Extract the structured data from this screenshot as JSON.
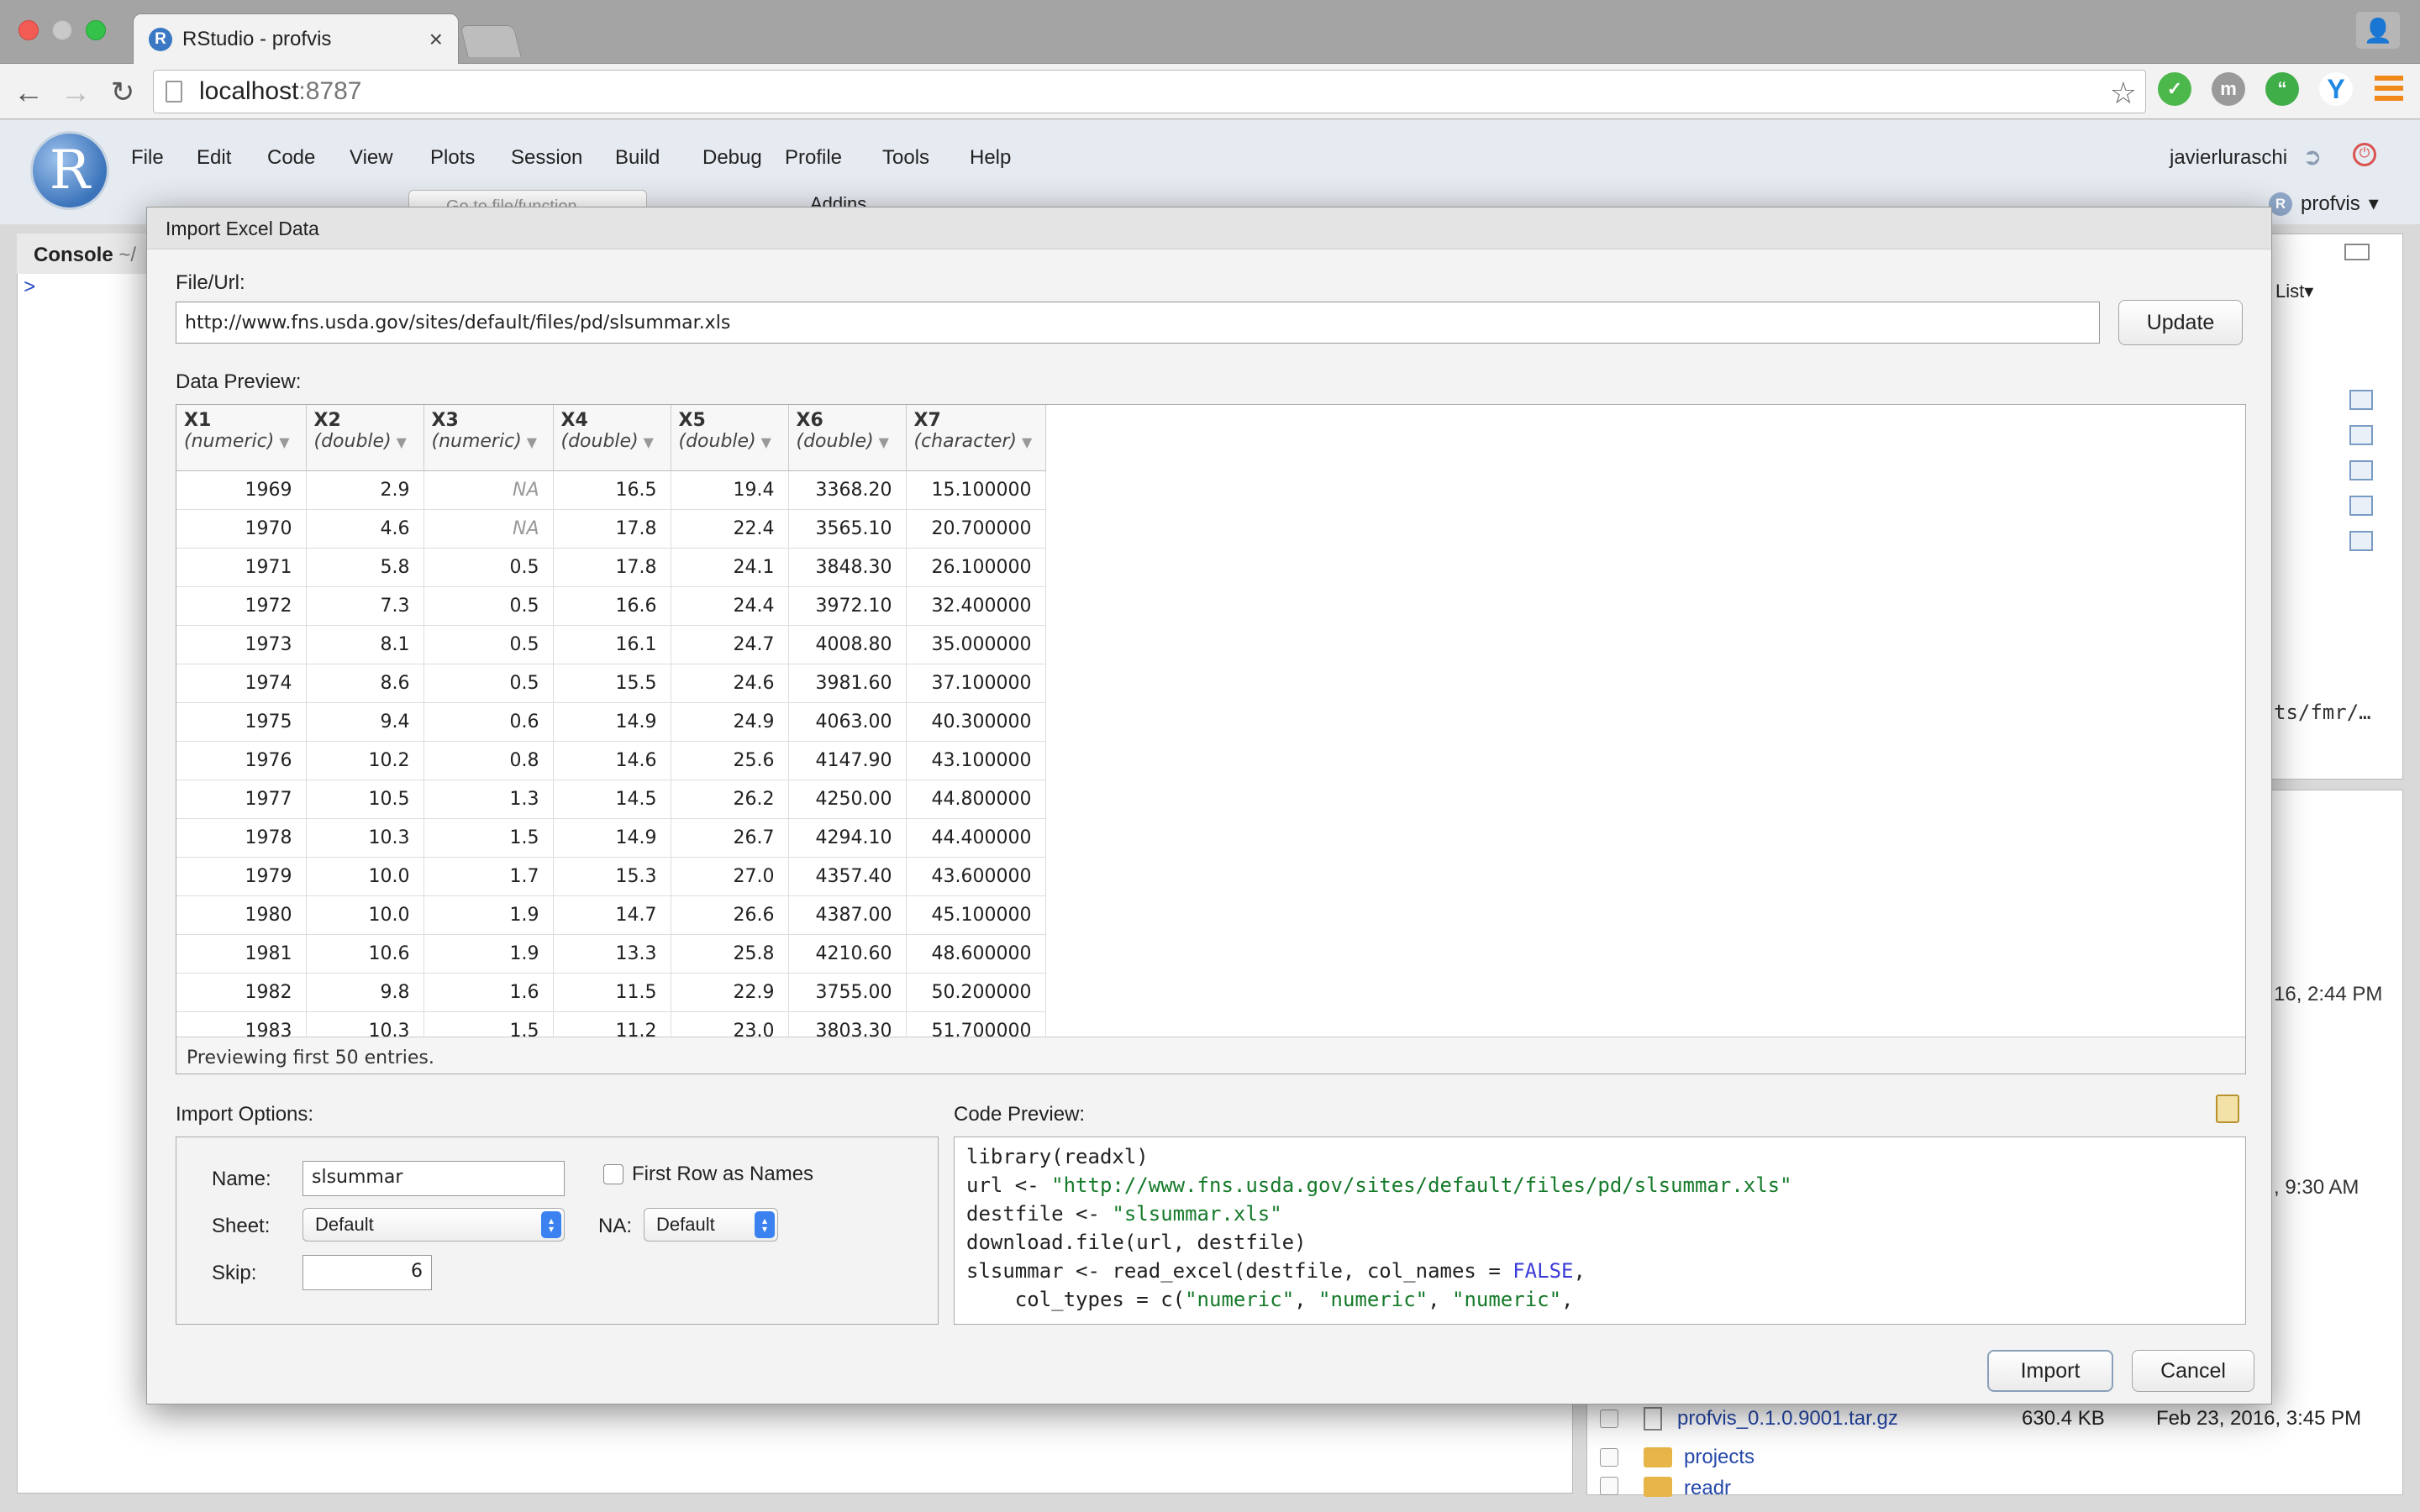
{
  "browser": {
    "tab_title": "RStudio - profvis",
    "tab_close": "×",
    "url_host": "localhost",
    "url_port": ":8787",
    "ext_m": "m"
  },
  "rstudio": {
    "logo": "R",
    "menu": [
      "File",
      "Edit",
      "Code",
      "View",
      "Plots",
      "Session",
      "Build",
      "Debug",
      "Profile",
      "Tools",
      "Help"
    ],
    "user": "javierluraschi",
    "project": "profvis",
    "project_arrow": "▾",
    "go_to_file": "Go to file/function",
    "addins": "Addins",
    "console_tab": "Console",
    "console_path": "~/",
    "prompt": ">",
    "env_view": "List",
    "env_path_fragment": "ts/fmr/…",
    "file_dates_partial": [
      "16, 2:44 PM",
      ", 9:30 AM"
    ],
    "files": [
      {
        "name": "profvis_0.1.0.9001.tar.gz",
        "size": "630.4 KB",
        "date": "Feb 23, 2016, 3:45 PM",
        "folder": false
      },
      {
        "name": "projects",
        "size": "",
        "date": "",
        "folder": true
      },
      {
        "name": "readr",
        "size": "",
        "date": "",
        "folder": true
      }
    ]
  },
  "dialog": {
    "title": "Import Excel Data",
    "file_label": "File/Url:",
    "url_value": "http://www.fns.usda.gov/sites/default/files/pd/slsummar.xls",
    "update_button": "Update",
    "data_preview_label": "Data Preview:",
    "columns": [
      {
        "name": "X1",
        "type": "(numeric)"
      },
      {
        "name": "X2",
        "type": "(double)"
      },
      {
        "name": "X3",
        "type": "(numeric)"
      },
      {
        "name": "X4",
        "type": "(double)"
      },
      {
        "name": "X5",
        "type": "(double)"
      },
      {
        "name": "X6",
        "type": "(double)"
      },
      {
        "name": "X7",
        "type": "(character)"
      }
    ],
    "rows": [
      [
        "1969",
        "2.9",
        "NA",
        "16.5",
        "19.4",
        "3368.20",
        "15.100000"
      ],
      [
        "1970",
        "4.6",
        "NA",
        "17.8",
        "22.4",
        "3565.10",
        "20.700000"
      ],
      [
        "1971",
        "5.8",
        "0.5",
        "17.8",
        "24.1",
        "3848.30",
        "26.100000"
      ],
      [
        "1972",
        "7.3",
        "0.5",
        "16.6",
        "24.4",
        "3972.10",
        "32.400000"
      ],
      [
        "1973",
        "8.1",
        "0.5",
        "16.1",
        "24.7",
        "4008.80",
        "35.000000"
      ],
      [
        "1974",
        "8.6",
        "0.5",
        "15.5",
        "24.6",
        "3981.60",
        "37.100000"
      ],
      [
        "1975",
        "9.4",
        "0.6",
        "14.9",
        "24.9",
        "4063.00",
        "40.300000"
      ],
      [
        "1976",
        "10.2",
        "0.8",
        "14.6",
        "25.6",
        "4147.90",
        "43.100000"
      ],
      [
        "1977",
        "10.5",
        "1.3",
        "14.5",
        "26.2",
        "4250.00",
        "44.800000"
      ],
      [
        "1978",
        "10.3",
        "1.5",
        "14.9",
        "26.7",
        "4294.10",
        "44.400000"
      ],
      [
        "1979",
        "10.0",
        "1.7",
        "15.3",
        "27.0",
        "4357.40",
        "43.600000"
      ],
      [
        "1980",
        "10.0",
        "1.9",
        "14.7",
        "26.6",
        "4387.00",
        "45.100000"
      ],
      [
        "1981",
        "10.6",
        "1.9",
        "13.3",
        "25.8",
        "4210.60",
        "48.600000"
      ],
      [
        "1982",
        "9.8",
        "1.6",
        "11.5",
        "22.9",
        "3755.00",
        "50.200000"
      ],
      [
        "1983",
        "10.3",
        "1.5",
        "11.2",
        "23.0",
        "3803.30",
        "51.700000"
      ]
    ],
    "preview_status": "Previewing first 50 entries.",
    "import_options_label": "Import Options:",
    "name_label": "Name:",
    "name_value": "slsummar",
    "first_row_label": "First Row as Names",
    "sheet_label": "Sheet:",
    "sheet_value": "Default",
    "na_label": "NA:",
    "na_value": "Default",
    "skip_label": "Skip:",
    "skip_value": "6",
    "code_preview_label": "Code Preview:",
    "code_lines": [
      [
        {
          "t": "library(readxl)",
          "c": "fn"
        }
      ],
      [
        {
          "t": "url <- ",
          "c": "fn"
        },
        {
          "t": "\"http://www.fns.usda.gov/sites/default/files/pd/slsummar.xls\"",
          "c": "str"
        }
      ],
      [
        {
          "t": "destfile <- ",
          "c": "fn"
        },
        {
          "t": "\"slsummar.xls\"",
          "c": "str"
        }
      ],
      [
        {
          "t": "download.file(url, destfile)",
          "c": "fn"
        }
      ],
      [
        {
          "t": "slsummar <- read_excel(destfile, col_names = ",
          "c": "fn"
        },
        {
          "t": "FALSE",
          "c": "kw"
        },
        {
          "t": ",",
          "c": "fn"
        }
      ],
      [
        {
          "t": "    col_types = c(",
          "c": "fn"
        },
        {
          "t": "\"numeric\"",
          "c": "str"
        },
        {
          "t": ", ",
          "c": "fn"
        },
        {
          "t": "\"numeric\"",
          "c": "str"
        },
        {
          "t": ", ",
          "c": "fn"
        },
        {
          "t": "\"numeric\"",
          "c": "str"
        },
        {
          "t": ",",
          "c": "fn"
        }
      ]
    ],
    "import_button": "Import",
    "cancel_button": "Cancel"
  },
  "colors": {
    "accent_blue": "#3b82f0",
    "string_green": "#157a2a",
    "keyword_blue": "#3b3bd8",
    "link_blue": "#2447a8"
  },
  "icons": [
    "close-window-light",
    "minimize-light",
    "zoom-light",
    "back-icon",
    "forward-icon",
    "reload-icon",
    "page-icon",
    "star-icon",
    "clipboard-icon",
    "folder-icon",
    "file-icon",
    "grid-icon",
    "power-icon",
    "logout-icon",
    "user-profile-icon"
  ]
}
